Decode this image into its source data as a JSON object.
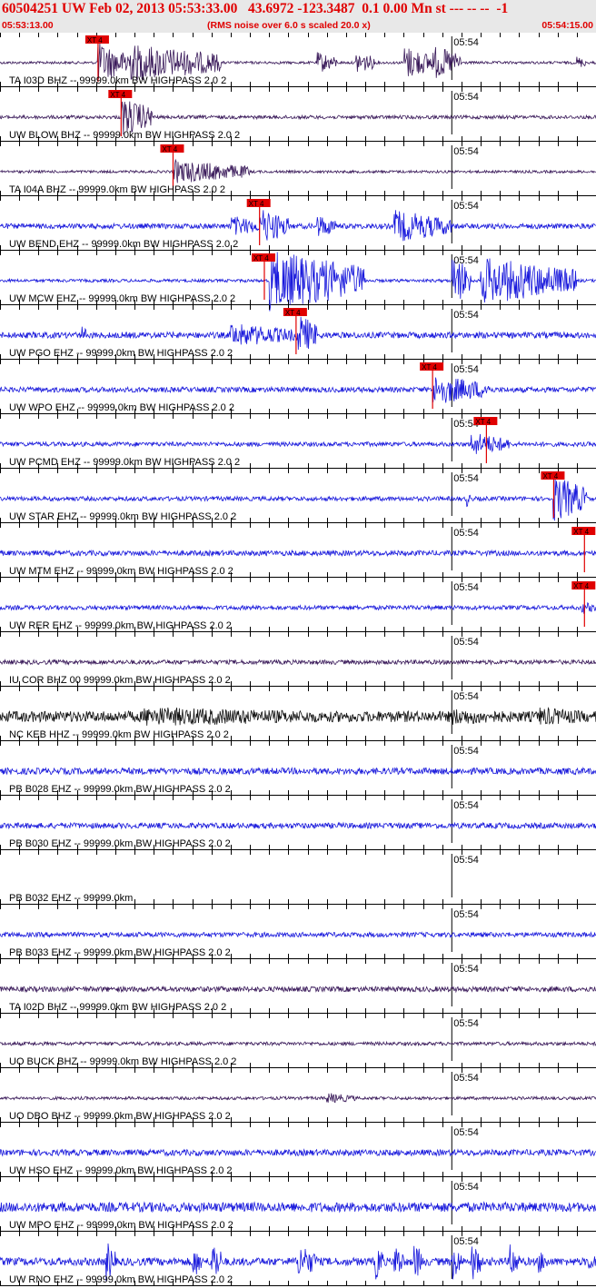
{
  "header": {
    "title": "60504251 UW Feb 02, 2013 05:53:33.00   43.6972 -123.3487  0.1 0.00 Mn st --- -- --  -1",
    "start_time": "05:53:13.00",
    "note": "(RMS noise over 6.0 s scaled 20.0 x)",
    "end_time": "05:54:15.00"
  },
  "colors": {
    "header_text": "#e00000",
    "header_bg": "#e8e8e8",
    "pick_box": "#e00000",
    "pick_text": "#000000"
  },
  "chart_data": {
    "type": "line",
    "title": "60504251 UW Feb 02, 2013 05:53:33.00   43.6972 -123.3487  0.1 0.00 Mn st --- -- --  -1",
    "x_range": [
      "05:53:13.00",
      "05:54:15.00"
    ],
    "minute_label": "05:54",
    "minute_label_time": "05:54:00",
    "tick_interval_s": 2,
    "pick_label": "XT 4",
    "grid": false,
    "series": [
      {
        "name": "TA I03D BHZ -- 99999.0km BW  HIGHPASS  2.0  2",
        "color": "#3a1a5a",
        "pick_time_s": 10.2,
        "bursts": [
          [
            10,
            13,
            1.0
          ],
          [
            13,
            23,
            0.9
          ],
          [
            33,
            35,
            0.5
          ],
          [
            37,
            39,
            0.55
          ],
          [
            42,
            45,
            0.8
          ],
          [
            45,
            48,
            0.8
          ],
          [
            60,
            61,
            0.3
          ]
        ],
        "noise": 0.06,
        "tail": 0
      },
      {
        "name": "UW BLOW BHZ -- 99999.0km BW  HIGHPASS  2.0  2",
        "color": "#3a1a5a",
        "pick_time_s": 12.6,
        "bursts": [
          [
            12.6,
            16,
            0.9
          ]
        ],
        "noise": 0.08,
        "tail": 0
      },
      {
        "name": "TA I04A BHZ -- 99999.0km BW  HIGHPASS  2.0  2",
        "color": "#3a1a5a",
        "pick_time_s": 18.0,
        "bursts": [
          [
            18,
            26,
            0.55
          ]
        ],
        "noise": 0.06,
        "tail": 0
      },
      {
        "name": "UW BEND EHZ -- 99999.0km BW  HIGHPASS  2.0  2",
        "color": "#1a1adc",
        "pick_time_s": 27.0,
        "bursts": [
          [
            24,
            27,
            0.5
          ],
          [
            27,
            30,
            0.85
          ],
          [
            33,
            35,
            0.55
          ],
          [
            41,
            47,
            0.75
          ]
        ],
        "noise": 0.12,
        "tail": 0
      },
      {
        "name": "UW MCW EHZ -- 99999.0km BW  HIGHPASS  2.0  2",
        "color": "#1a1adc",
        "pick_time_s": 27.5,
        "bursts": [
          [
            28,
            38,
            1.4
          ],
          [
            47,
            49,
            1.2
          ],
          [
            50,
            60,
            1.1
          ]
        ],
        "noise": 0.07,
        "tail": 0
      },
      {
        "name": "UW PGO EHZ -- 99999.0km BW  HIGHPASS  2.0  2",
        "color": "#1a1adc",
        "pick_time_s": 30.8,
        "bursts": [
          [
            8.5,
            9,
            0.5
          ],
          [
            24,
            31,
            0.55
          ],
          [
            31,
            33,
            1.0
          ]
        ],
        "noise": 0.14,
        "tail": 0
      },
      {
        "name": "UW WPO EHZ -- 99999.0km BW  HIGHPASS  2.0  2",
        "color": "#1a1adc",
        "pick_time_s": 45.0,
        "bursts": [
          [
            45,
            51,
            0.7
          ]
        ],
        "noise": 0.12,
        "tail": 0
      },
      {
        "name": "UW PCMD EHZ -- 99999.0km BW  HIGHPASS  2.0  2",
        "color": "#1a1adc",
        "pick_time_s": 50.6,
        "bursts": [
          [
            49,
            53,
            0.55
          ]
        ],
        "noise": 0.1,
        "tail": 0
      },
      {
        "name": "UW STAR EHZ -- 99999.0km BW  HIGHPASS  2.0  2",
        "color": "#1a1adc",
        "pick_time_s": 57.6,
        "bursts": [
          [
            48.5,
            49,
            0.4
          ],
          [
            57.5,
            61,
            1.1
          ]
        ],
        "noise": 0.1,
        "tail": 0
      },
      {
        "name": "UW MTM EHZ -- 99999.0km BW  HIGHPASS  2.0  2",
        "color": "#1a1adc",
        "pick_time_s": 60.8,
        "bursts": [],
        "noise": 0.12,
        "tail": 0
      },
      {
        "name": "UW RER EHZ -- 99999.0km BW  HIGHPASS  2.0  2",
        "color": "#1a1adc",
        "pick_time_s": 60.8,
        "bursts": [
          [
            60.5,
            62,
            0.3
          ]
        ],
        "noise": 0.1,
        "tail": 0
      },
      {
        "name": "IU COR BHZ 00 99999.0km BW  HIGHPASS  2.0  2",
        "color": "#3a1a5a",
        "pick_time_s": null,
        "bursts": [],
        "noise": 0.1,
        "tail": 0
      },
      {
        "name": "NC KEB HHZ -- 99999.0km BW  HIGHPASS  2.0  2",
        "color": "#111111",
        "pick_time_s": null,
        "bursts": [
          [
            15,
            38,
            0.45
          ],
          [
            47,
            55,
            0.4
          ],
          [
            56,
            62,
            0.45
          ]
        ],
        "noise": 0.25,
        "tail": 0
      },
      {
        "name": "PB B028 EHZ -- 99999.0km BW  HIGHPASS  2.0  2",
        "color": "#1a1adc",
        "pick_time_s": null,
        "bursts": [],
        "noise": 0.15,
        "tail": 0
      },
      {
        "name": "PB B030 EHZ -- 99999.0km BW  HIGHPASS  2.0  2",
        "color": "#1a1adc",
        "pick_time_s": null,
        "bursts": [],
        "noise": 0.13,
        "tail": 0
      },
      {
        "name": "PB B032 EHZ -- 99999.0km",
        "color": "#1a1adc",
        "pick_time_s": null,
        "bursts": [],
        "noise": 0,
        "tail": 0
      },
      {
        "name": "PB B033 EHZ -- 99999.0km BW  HIGHPASS  2.0  2",
        "color": "#1a1adc",
        "pick_time_s": null,
        "bursts": [],
        "noise": 0.11,
        "tail": 0
      },
      {
        "name": "TA I02D BHZ -- 99999.0km BW  HIGHPASS  2.0  2",
        "color": "#3a1a5a",
        "pick_time_s": null,
        "bursts": [],
        "noise": 0.12,
        "tail": 0
      },
      {
        "name": "UO BUCK BHZ -- 99999.0km BW  HIGHPASS  2.0  2",
        "color": "#3a1a5a",
        "pick_time_s": null,
        "bursts": [],
        "noise": 0.08,
        "tail": 0
      },
      {
        "name": "UO DBO BHZ -- 99999.0km BW  HIGHPASS  2.0  2",
        "color": "#3a1a5a",
        "pick_time_s": null,
        "bursts": [
          [
            34,
            37,
            0.25
          ]
        ],
        "noise": 0.07,
        "tail": 0
      },
      {
        "name": "UW HSO EHZ -- 99999.0km BW  HIGHPASS  2.0  2",
        "color": "#1a1adc",
        "pick_time_s": null,
        "bursts": [],
        "noise": 0.14,
        "tail": 0
      },
      {
        "name": "UW MPO EHZ -- 99999.0km BW  HIGHPASS  2.0  2",
        "color": "#1a1adc",
        "pick_time_s": null,
        "bursts": [],
        "noise": 0.22,
        "tail": 0
      },
      {
        "name": "UW RNO EHZ -- 99999.0km BW  HIGHPASS  2.0  2",
        "color": "#1a1adc",
        "pick_time_s": null,
        "bursts": [
          [
            11,
            12,
            1.0
          ],
          [
            20,
            21,
            0.8
          ],
          [
            22,
            23,
            1.1
          ],
          [
            31,
            33,
            0.8
          ],
          [
            39,
            40,
            0.9
          ],
          [
            41,
            42,
            0.9
          ],
          [
            43,
            44,
            0.9
          ],
          [
            47,
            48,
            0.9
          ],
          [
            49,
            50,
            1.0
          ],
          [
            53,
            54,
            0.9
          ],
          [
            56,
            57,
            0.6
          ],
          [
            61,
            62,
            0.5
          ]
        ],
        "noise": 0.18,
        "tail": 0
      }
    ]
  }
}
